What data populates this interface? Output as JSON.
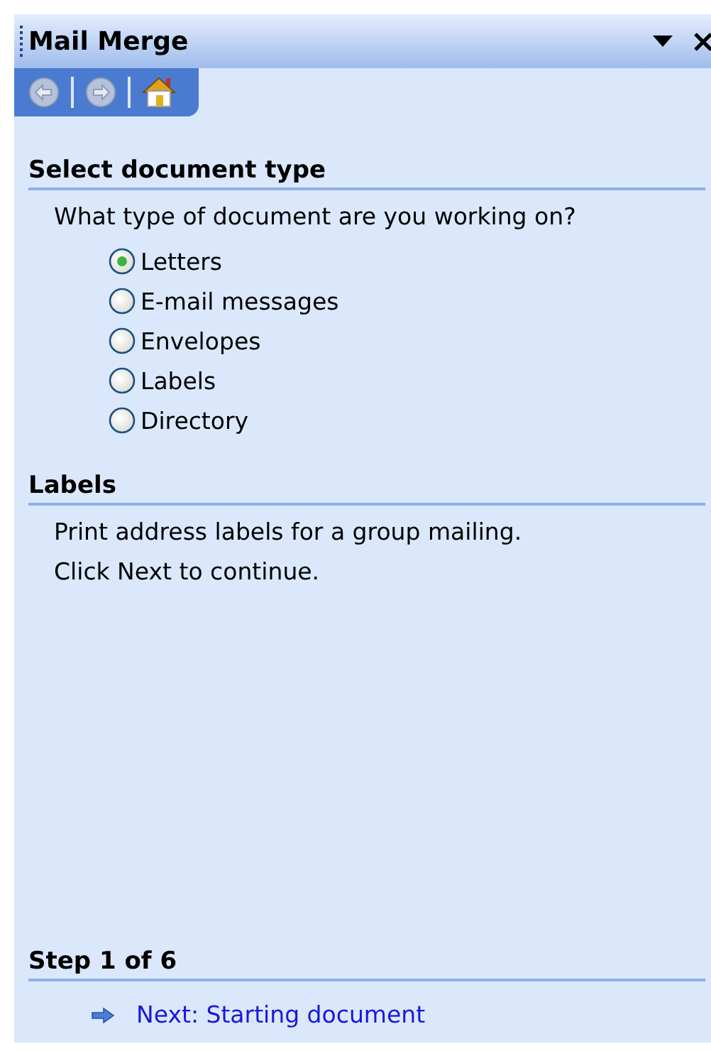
{
  "panel": {
    "title": "Mail Merge"
  },
  "nav_buttons": [
    {
      "kind": "back",
      "disabled": true
    },
    {
      "kind": "forward",
      "disabled": true
    },
    {
      "kind": "home",
      "disabled": false
    }
  ],
  "sections": [
    {
      "heading": "Select document type",
      "question": "What type of document are you working on?",
      "options": [
        {
          "label": "Letters",
          "selected": true
        },
        {
          "label": "E-mail messages",
          "selected": false
        },
        {
          "label": "Envelopes",
          "selected": false
        },
        {
          "label": "Labels",
          "selected": false
        },
        {
          "label": "Directory",
          "selected": false
        }
      ]
    },
    {
      "heading": "Labels",
      "paragraphs": [
        "Print address labels for a group mailing.",
        "Click Next to continue."
      ]
    }
  ],
  "footer": {
    "heading": "Step 1 of 6",
    "next_link": "Next: Starting document"
  }
}
